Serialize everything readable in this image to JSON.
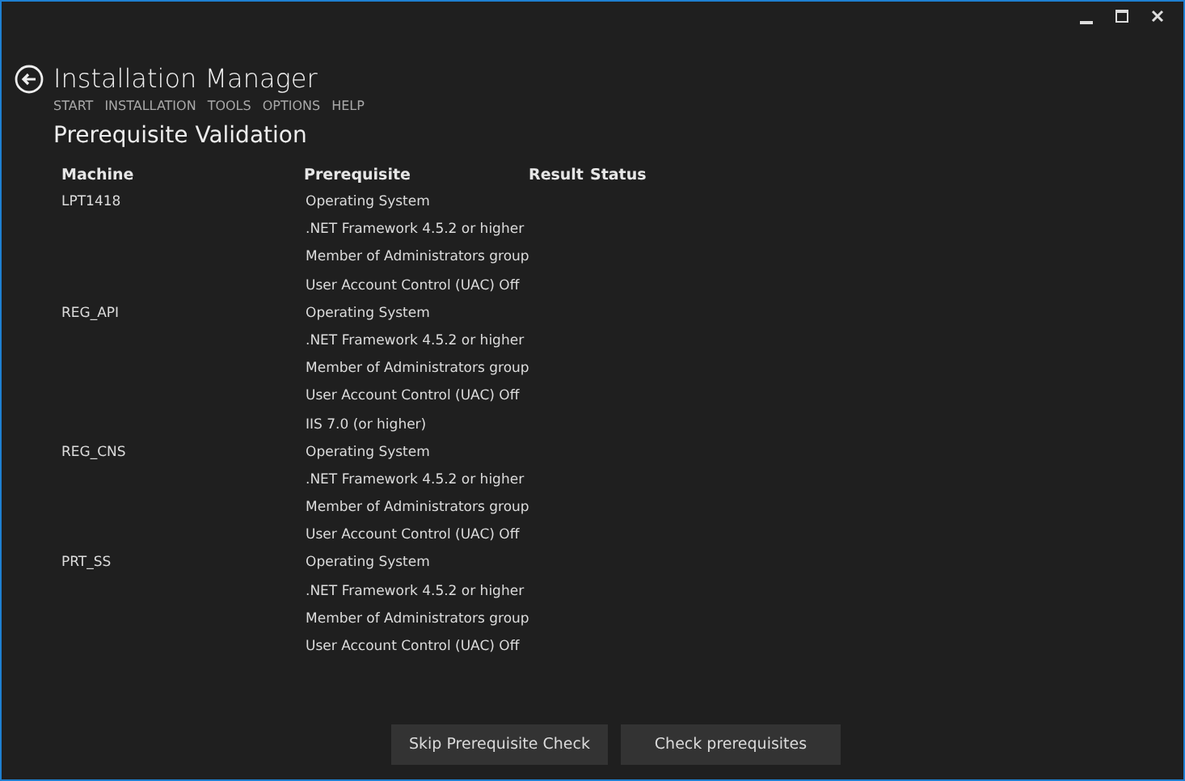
{
  "window": {
    "title": "Installation Manager"
  },
  "nav": [
    "START",
    "INSTALLATION",
    "TOOLS",
    "OPTIONS",
    "HELP"
  ],
  "page_title": "Prerequisite Validation",
  "table": {
    "columns": [
      "Machine",
      "Prerequisite",
      "Result",
      "Status"
    ],
    "machines": [
      {
        "name": "LPT1418",
        "prerequisites": [
          "Operating System",
          ".NET Framework 4.5.2 or higher",
          "Member of Administrators group",
          "User Account Control (UAC) Off"
        ]
      },
      {
        "name": "REG_API",
        "prerequisites": [
          "Operating System",
          ".NET Framework 4.5.2 or higher",
          "Member of Administrators group",
          "User Account Control (UAC) Off",
          "IIS 7.0 (or higher)"
        ]
      },
      {
        "name": "REG_CNS",
        "prerequisites": [
          "Operating System",
          ".NET Framework 4.5.2 or higher",
          "Member of Administrators group",
          "User Account Control (UAC) Off"
        ]
      },
      {
        "name": "PRT_SS",
        "prerequisites": [
          "Operating System",
          ".NET Framework 4.5.2 or higher",
          "Member of Administrators group",
          "User Account Control (UAC) Off"
        ]
      }
    ]
  },
  "buttons": [
    "Skip Prerequisite Check",
    "Check prerequisites"
  ]
}
